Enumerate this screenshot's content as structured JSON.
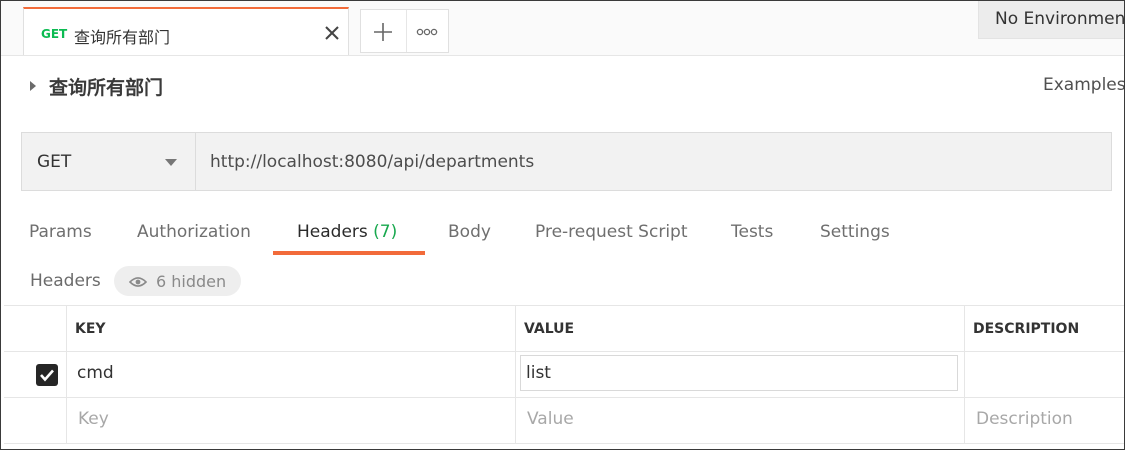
{
  "tab": {
    "method": "GET",
    "name": "查询所有部门",
    "close_icon": "close-icon"
  },
  "tab_actions": {
    "new_tab_icon": "plus-icon",
    "more_icon": "more-horizontal-icon"
  },
  "environment": {
    "selected": "No Environment"
  },
  "request": {
    "title": "查询所有部门",
    "examples_label": "Examples",
    "method": "GET",
    "url": "http://localhost:8080/api/departments"
  },
  "request_tabs": [
    {
      "label": "Params"
    },
    {
      "label": "Authorization"
    },
    {
      "label": "Headers",
      "count": "(7)",
      "active": true
    },
    {
      "label": "Body"
    },
    {
      "label": "Pre-request Script"
    },
    {
      "label": "Tests"
    },
    {
      "label": "Settings"
    }
  ],
  "headers_section": {
    "label": "Headers",
    "hidden_label": "6 hidden",
    "columns": [
      "KEY",
      "VALUE",
      "DESCRIPTION"
    ],
    "rows": [
      {
        "checked": true,
        "key": "cmd",
        "value": "list",
        "description": ""
      }
    ],
    "placeholders": {
      "key": "Key",
      "value": "Value",
      "description": "Description"
    }
  },
  "colors": {
    "accent": "#f26b3a",
    "get_method": "#0cbb52",
    "count": "#18a84e"
  }
}
